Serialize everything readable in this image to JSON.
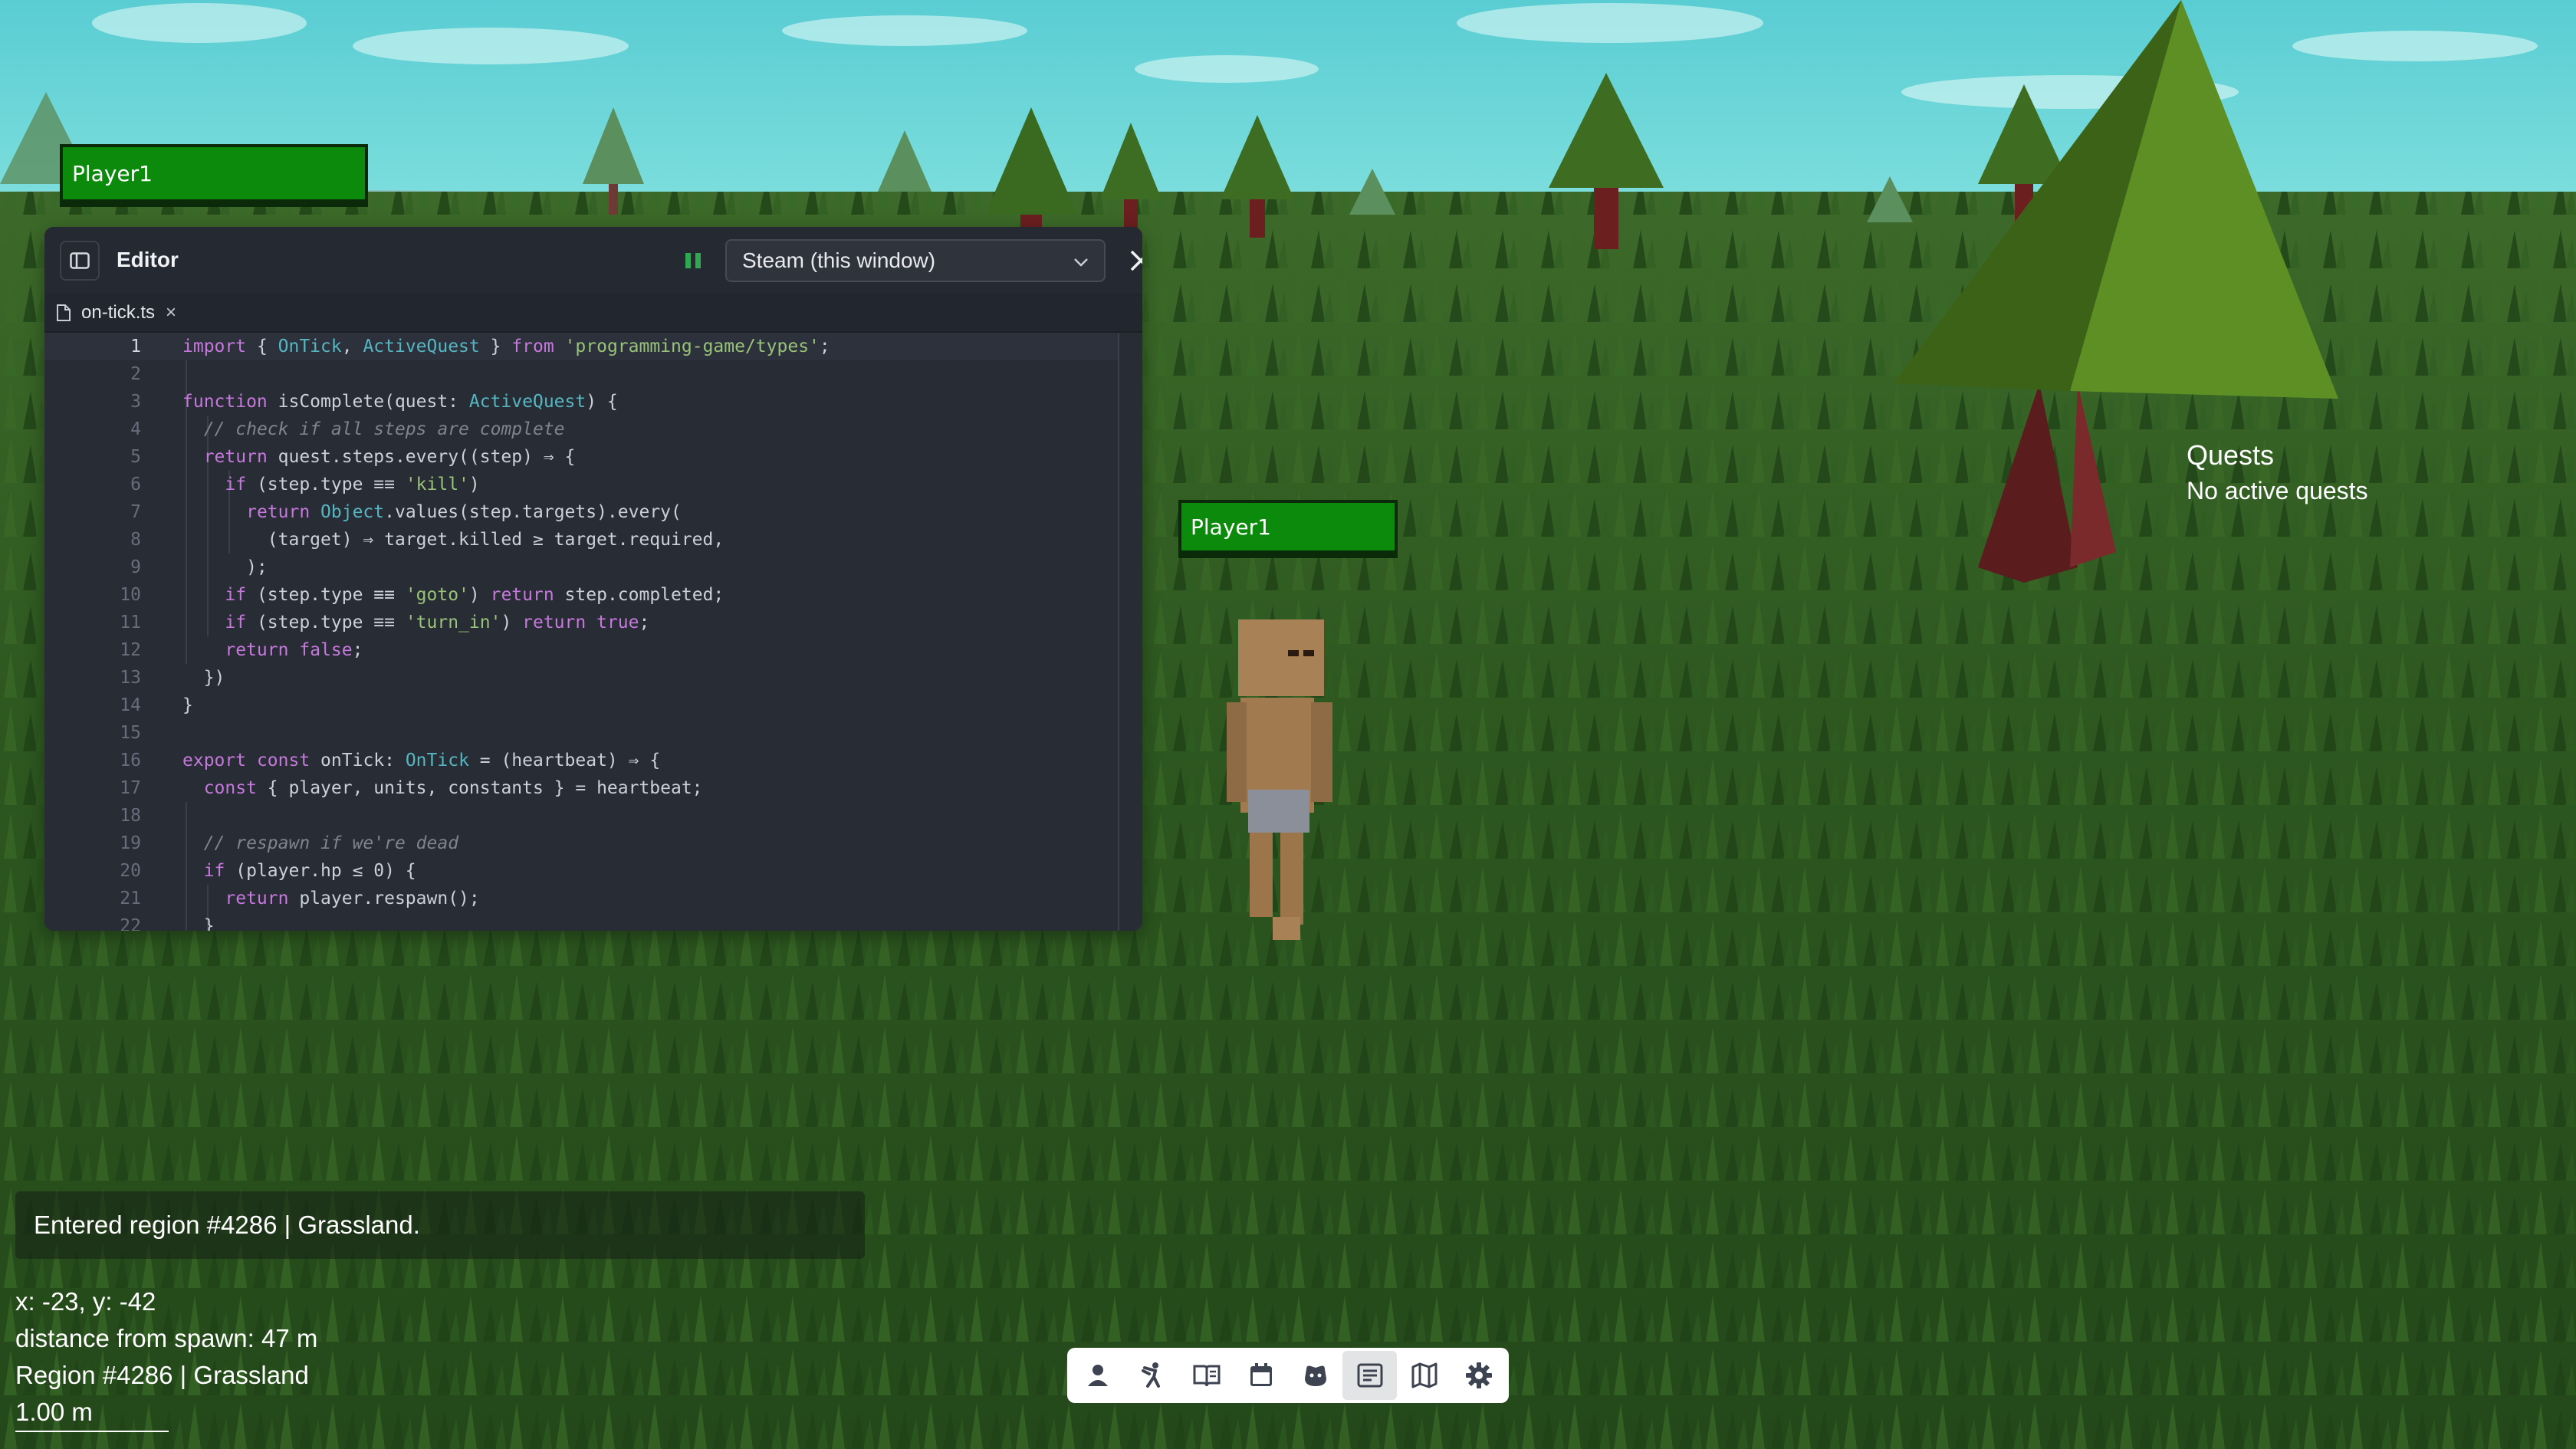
{
  "nameplates": {
    "top": "Player1",
    "character": "Player1"
  },
  "editor": {
    "title": "Editor",
    "output_select": "Steam (this window)",
    "tab": {
      "filename": "on-tick.ts",
      "close": "×"
    },
    "code_lines": [
      {
        "n": "1",
        "t": "import { OnTick, ActiveQuest } from 'programming-game/types';"
      },
      {
        "n": "2",
        "t": ""
      },
      {
        "n": "3",
        "t": "function isComplete(quest: ActiveQuest) {"
      },
      {
        "n": "4",
        "t": "  // check if all steps are complete"
      },
      {
        "n": "5",
        "t": "  return quest.steps.every((step) ⇒ {"
      },
      {
        "n": "6",
        "t": "    if (step.type ≡≡ 'kill')"
      },
      {
        "n": "7",
        "t": "      return Object.values(step.targets).every("
      },
      {
        "n": "8",
        "t": "        (target) ⇒ target.killed ≥ target.required,"
      },
      {
        "n": "9",
        "t": "      );"
      },
      {
        "n": "10",
        "t": "    if (step.type ≡≡ 'goto') return step.completed;"
      },
      {
        "n": "11",
        "t": "    if (step.type ≡≡ 'turn_in') return true;"
      },
      {
        "n": "12",
        "t": "    return false;"
      },
      {
        "n": "13",
        "t": "  })"
      },
      {
        "n": "14",
        "t": "}"
      },
      {
        "n": "15",
        "t": ""
      },
      {
        "n": "16",
        "t": "export const onTick: OnTick = (heartbeat) ⇒ {"
      },
      {
        "n": "17",
        "t": "  const { player, units, constants } = heartbeat;"
      },
      {
        "n": "18",
        "t": ""
      },
      {
        "n": "19",
        "t": "  // respawn if we're dead"
      },
      {
        "n": "20",
        "t": "  if (player.hp ≤ 0) {"
      },
      {
        "n": "21",
        "t": "    return player.respawn();"
      },
      {
        "n": "22",
        "t": "  }"
      }
    ]
  },
  "quests": {
    "title": "Quests",
    "empty": "No active quests"
  },
  "toast": "Entered region #4286 | Grassland.",
  "info": {
    "coords": "x: -23, y: -42",
    "distance": "distance from spawn: 47 m",
    "region": "Region #4286 | Grassland",
    "scale": "1.00 m"
  },
  "toolbar": {
    "items": [
      {
        "icon": "character-icon"
      },
      {
        "icon": "skills-icon"
      },
      {
        "icon": "journal-icon"
      },
      {
        "icon": "calendar-icon"
      },
      {
        "icon": "pet-icon"
      },
      {
        "icon": "editor-icon",
        "active": true
      },
      {
        "icon": "map-icon"
      },
      {
        "icon": "settings-icon"
      }
    ]
  },
  "colors": {
    "sky": "#5fd0d6",
    "grass": "#2e5a1f",
    "nameplate": "#0c8a0c",
    "editor_bg": "#282c34"
  }
}
